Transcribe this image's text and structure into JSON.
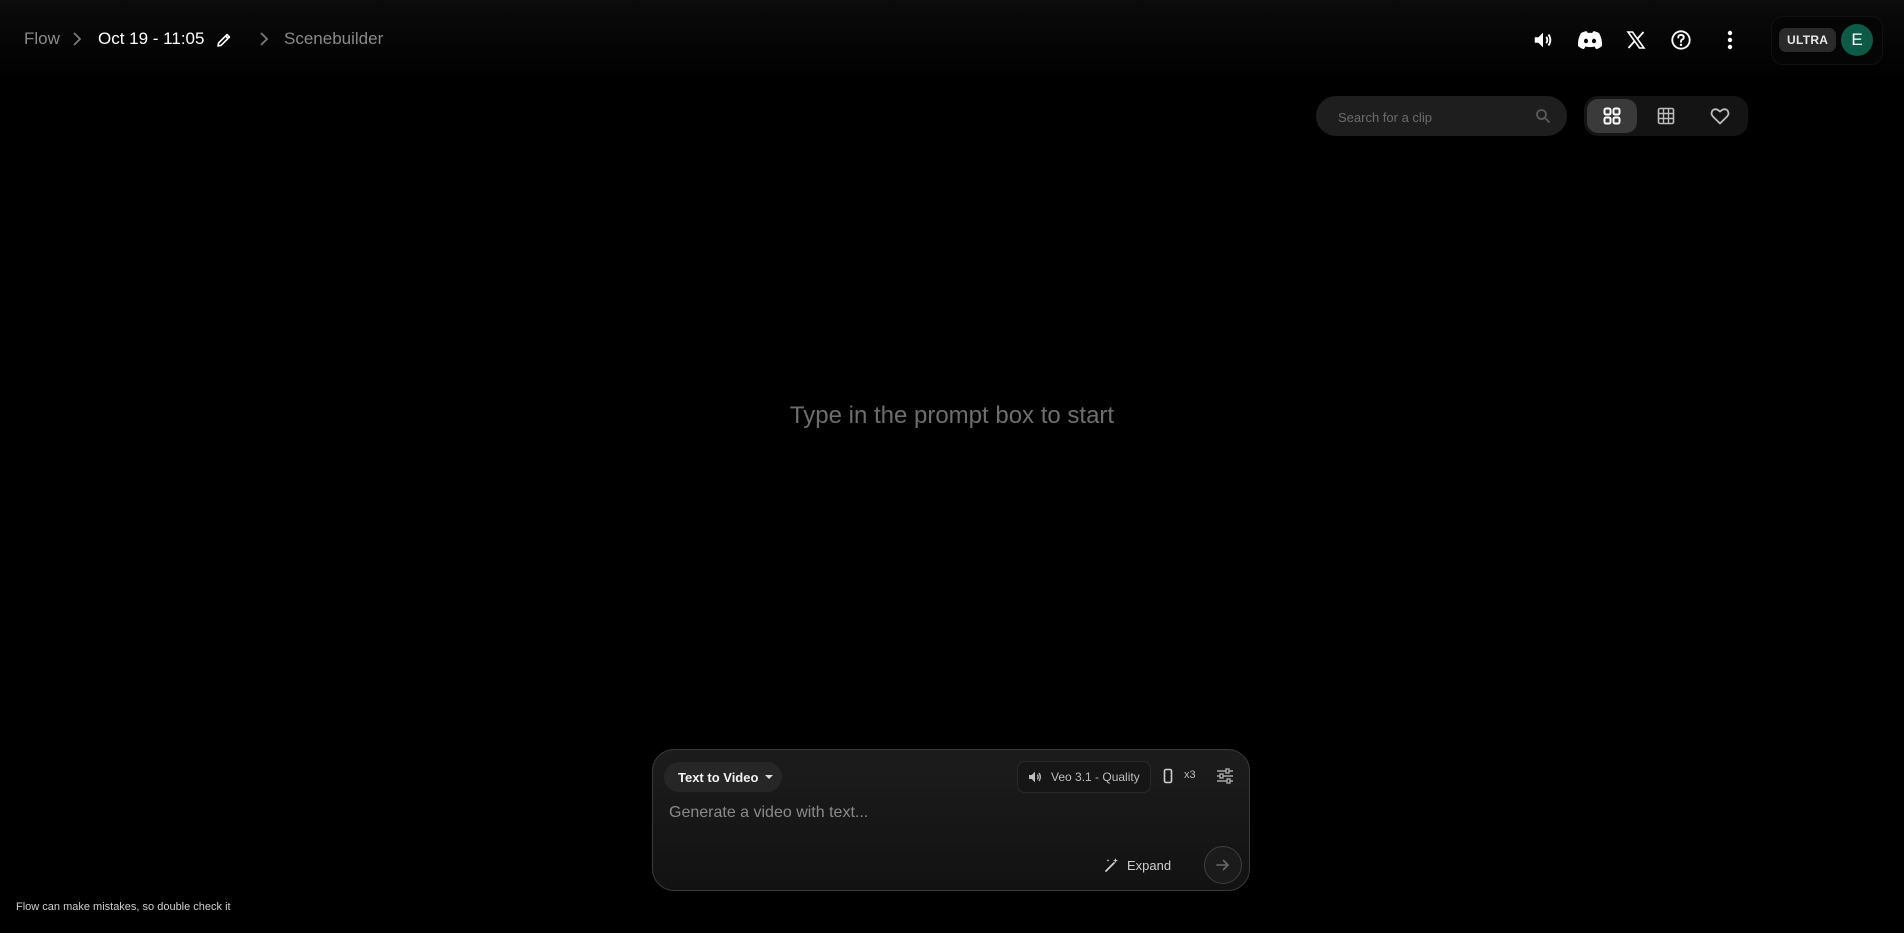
{
  "breadcrumb": {
    "root": "Flow",
    "project": "Oct 19 - 11:05",
    "current": "Scenebuilder"
  },
  "header": {
    "icons": [
      "volume-icon",
      "discord-icon",
      "x-icon",
      "help-icon",
      "more-vert-icon"
    ],
    "plan_badge": "ULTRA",
    "avatar_initial": "E",
    "avatar_color": "#0b5b47"
  },
  "search": {
    "placeholder": "Search for a clip"
  },
  "view_toggle": {
    "options": [
      "grid-view",
      "table-view",
      "favorites"
    ],
    "active": "grid-view"
  },
  "main": {
    "empty_message": "Type in the prompt box to start"
  },
  "composer": {
    "mode_label": "Text to Video",
    "model_label": "Veo 3.1 - Quality",
    "output_count": "x3",
    "prompt_placeholder": "Generate a video with text...",
    "expand_label": "Expand"
  },
  "footer": {
    "disclaimer": "Flow can make mistakes, so double check it"
  }
}
